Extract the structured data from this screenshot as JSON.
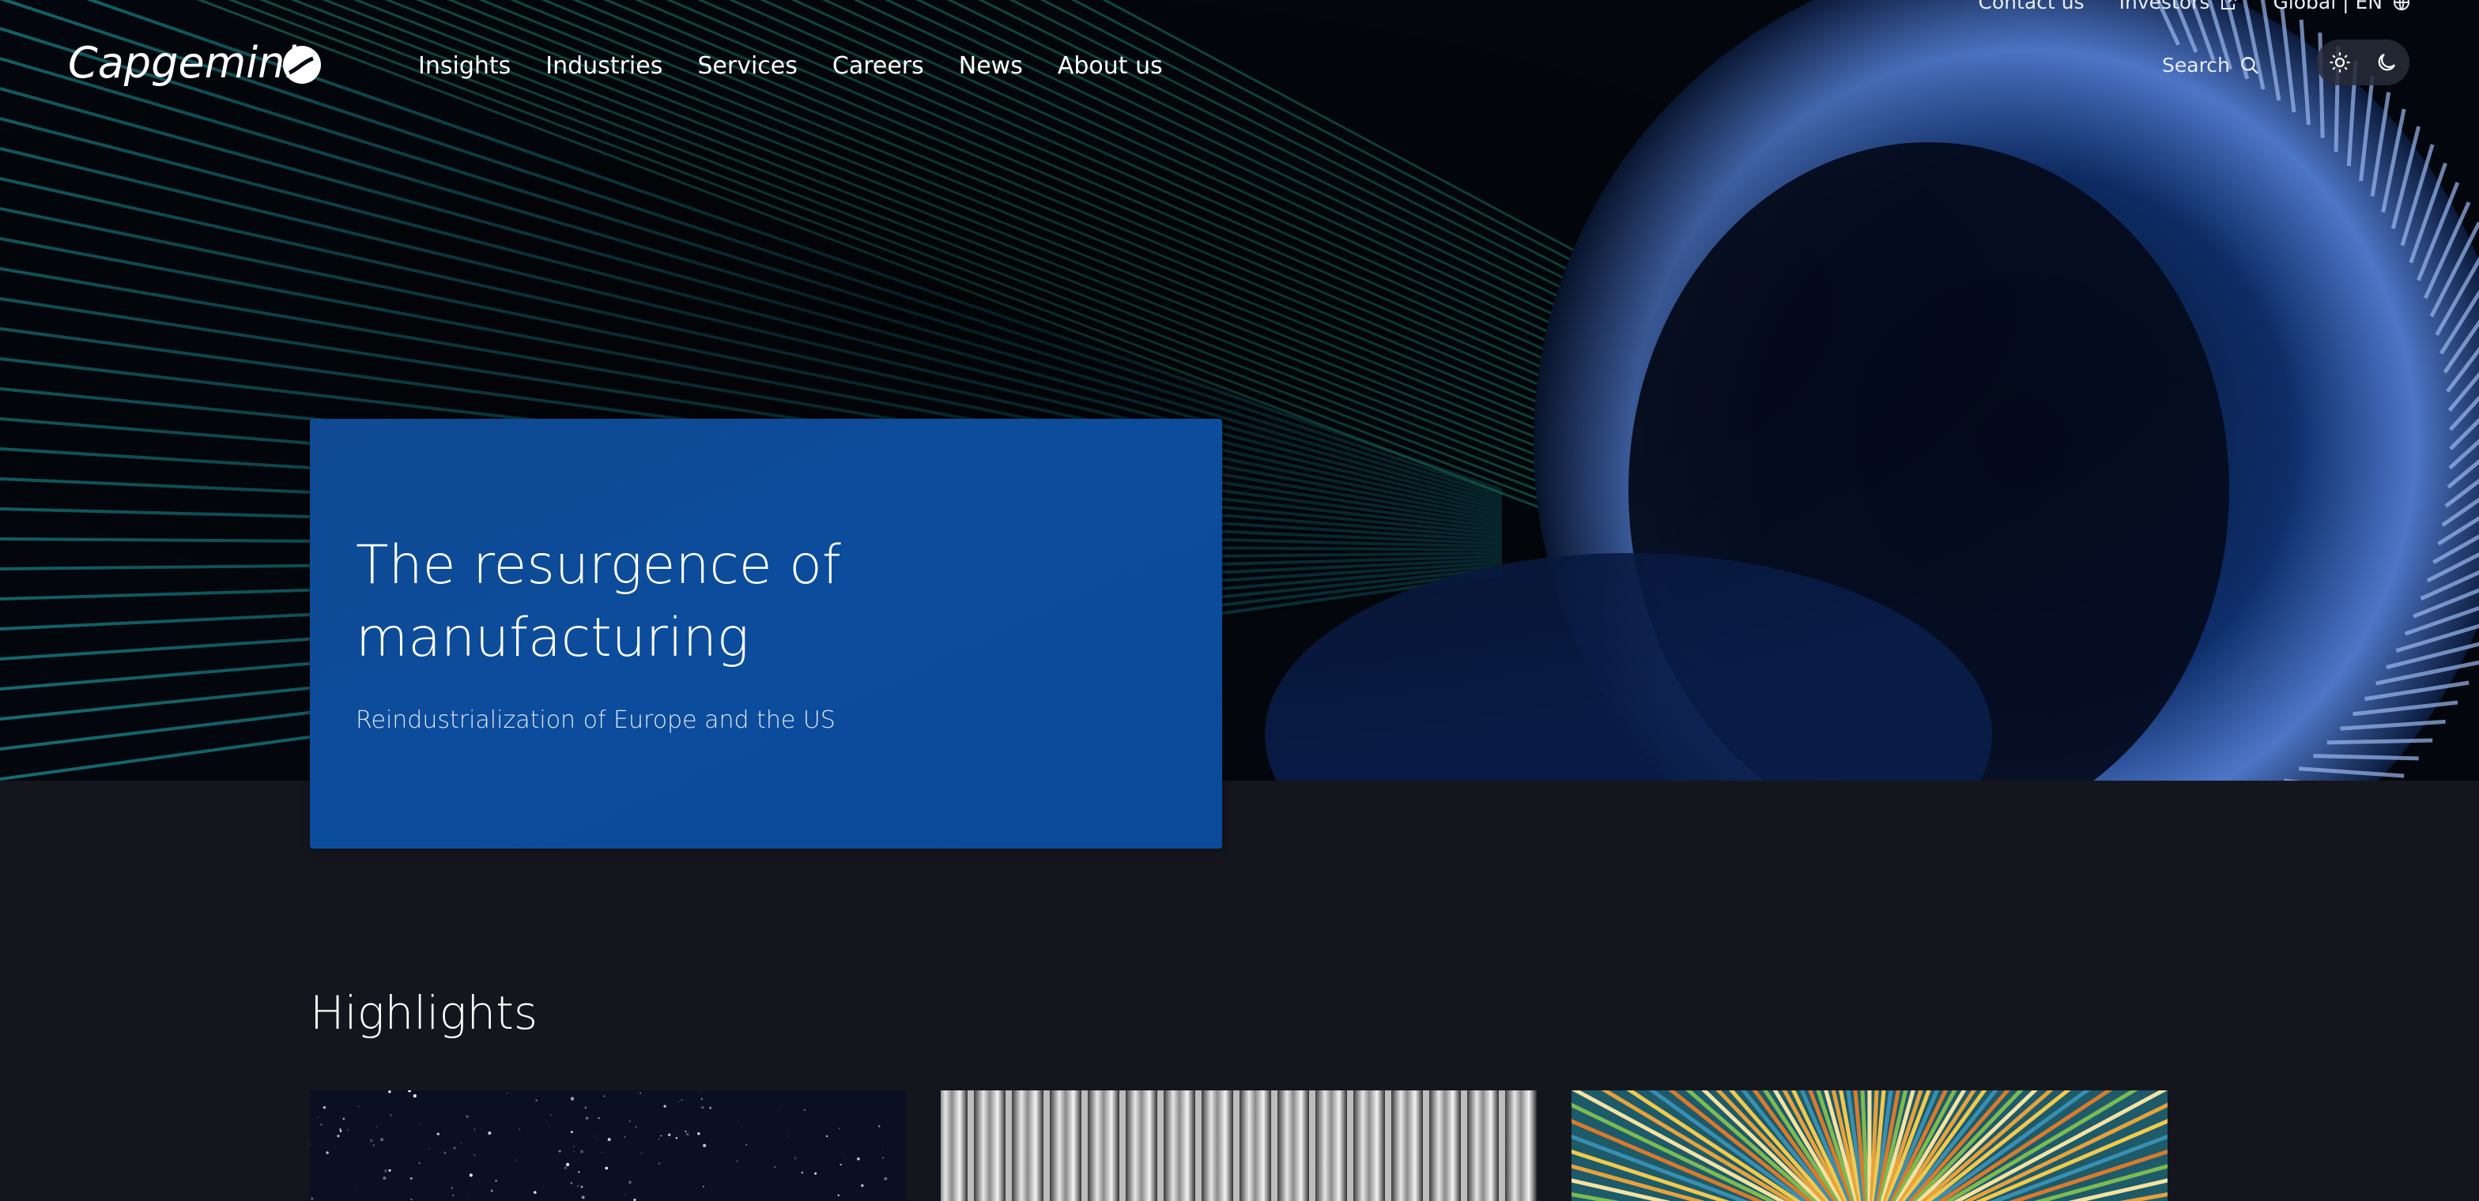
{
  "brand": {
    "name": "Capgemini",
    "logo_icon": "spade-icon"
  },
  "utility_nav": {
    "contact": "Contact us",
    "investors": "Investors",
    "investors_icon": "external-link-icon",
    "locale": "Global | EN",
    "locale_icon": "globe-icon"
  },
  "nav": {
    "items": [
      "Insights",
      "Industries",
      "Services",
      "Careers",
      "News",
      "About us"
    ]
  },
  "search": {
    "label": "Search",
    "icon": "search-icon"
  },
  "theme": {
    "light_icon": "sun-icon",
    "dark_icon": "moon-icon"
  },
  "hero": {
    "title": "The resurgence of manufacturing",
    "subtitle": "Reindustrialization of Europe and the US"
  },
  "highlights": {
    "title": "Highlights",
    "cards": [
      {
        "image": "starry-sky-image"
      },
      {
        "image": "metal-coils-image"
      },
      {
        "image": "colorful-burst-image"
      }
    ]
  },
  "colors": {
    "page_bg": "#15161d",
    "hero_card": "#0c4c9c",
    "accent_teal": "#1aa6a0"
  }
}
